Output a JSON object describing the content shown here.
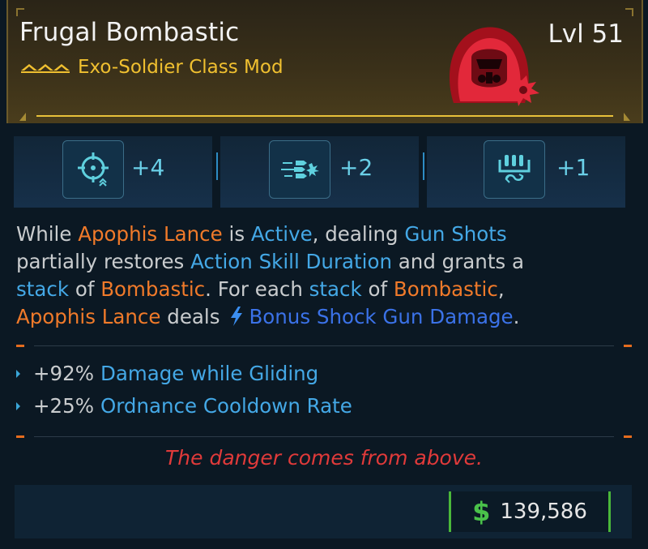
{
  "header": {
    "item_name": "Frugal Bombastic",
    "item_type": "Exo-Soldier Class Mod",
    "level": "Lvl 51",
    "class_icon": "exo-soldier-class-icon",
    "accent_color": "#e8c13a"
  },
  "stats": [
    {
      "icon": "crosshair-skill-icon",
      "value": "+4"
    },
    {
      "icon": "gun-shots-icon",
      "value": "+2"
    },
    {
      "icon": "ammo-cycle-icon",
      "value": "+1"
    }
  ],
  "description": {
    "t1": "While ",
    "t2": "Apophis Lance",
    "t3": " is ",
    "t4": "Active",
    "t5": ", dealing ",
    "t6": "Gun Shots",
    "t7": "partially restores ",
    "t8": "Action Skill Duration",
    "t9": " and grants a",
    "t10": "stack",
    "t11": " of ",
    "t12": "Bombastic",
    "t13": ". For each ",
    "t14": "stack",
    "t15": " of ",
    "t16": "Bombastic",
    "t17": ",",
    "t18": "Apophis Lance",
    "t19": " deals",
    "t20": "Bonus Shock Gun Damage",
    "t21": "."
  },
  "bonuses": [
    {
      "amount": "+92%",
      "stat": "Damage while Gliding"
    },
    {
      "amount": "+25%",
      "stat": "Ordnance Cooldown Rate"
    }
  ],
  "flavor_text": "The danger comes from above.",
  "price": {
    "currency_symbol": "$",
    "value": "139,586"
  }
}
